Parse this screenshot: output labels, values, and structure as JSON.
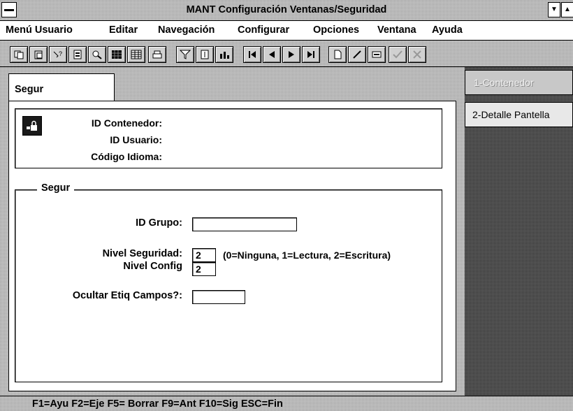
{
  "window": {
    "title": "MANT Configuración Ventanas/Seguridad",
    "minimize_glyph": "▼",
    "maximize_glyph": "▲"
  },
  "menu": {
    "items": [
      {
        "label": "Menú Usuario"
      },
      {
        "label": "Editar"
      },
      {
        "label": "Navegación"
      },
      {
        "label": "Configurar"
      },
      {
        "label": "Opciones"
      },
      {
        "label": "Ventana"
      },
      {
        "label": "Ayuda"
      }
    ]
  },
  "toolbar": {
    "icons": [
      "copy-icon",
      "paste-icon",
      "help-query-icon",
      "calendar-icon",
      "zoom-icon",
      "grid-icon",
      "table-icon",
      "print-icon",
      "filter-icon",
      "list-icon",
      "chart-icon",
      "first-record-icon",
      "prev-record-icon",
      "next-record-icon",
      "last-record-icon",
      "new-icon",
      "edit-icon",
      "delete-icon",
      "accept-icon",
      "cancel-icon"
    ]
  },
  "tabs": {
    "active": "Segur"
  },
  "header": {
    "labels": {
      "container_id": "ID Contenedor:",
      "user_id": "ID Usuario:",
      "language_code": "Código Idioma:"
    }
  },
  "segur_group": {
    "title": "Segur",
    "group_id_label": "ID Grupo:",
    "group_id_value": "",
    "security_level_label": "Nivel Seguridad:",
    "security_level_value": "2",
    "security_level_hint": "(0=Ninguna, 1=Lectura, 2=Escritura)",
    "config_level_label": "Nivel Config",
    "config_level_value": "2",
    "hide_labels_label": "Ocultar Etiq Campos?:",
    "hide_labels_value": ""
  },
  "side_nav": {
    "item1": "1-Contenedor",
    "item2": "2-Detalle Pantella"
  },
  "status_bar": {
    "text": "F1=Ayu  F2=Eje  F5= Borrar  F9=Ant  F10=Sig  ESC=Fin"
  }
}
